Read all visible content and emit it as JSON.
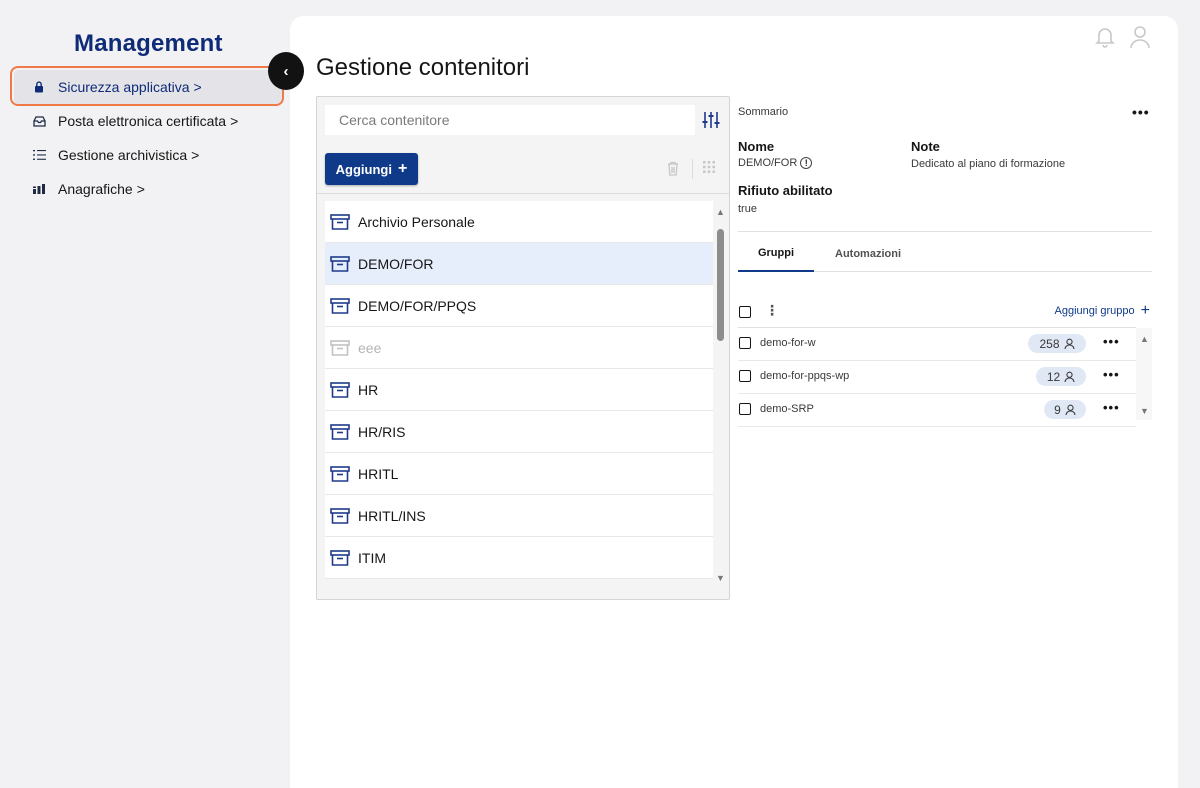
{
  "sidebar": {
    "title": "Management",
    "items": [
      {
        "label": "Sicurezza applicativa",
        "icon": "lock-icon",
        "chevron": ">"
      },
      {
        "label": "Posta elettronica certificata",
        "icon": "inbox-icon",
        "chevron": ">"
      },
      {
        "label": "Gestione archivistica",
        "icon": "list-icon",
        "chevron": ">"
      },
      {
        "label": "Anagrafiche",
        "icon": "chart-icon",
        "chevron": ">"
      }
    ],
    "collapse_glyph": "‹"
  },
  "header": {
    "title": "Gestione contenitori",
    "icons": [
      "bell-icon",
      "user-icon"
    ]
  },
  "list_panel": {
    "search_placeholder": "Cerca contenitore",
    "add_label": "Aggiungi",
    "add_plus": "+",
    "items": [
      {
        "label": "Archivio Personale",
        "state": "normal"
      },
      {
        "label": "DEMO/FOR",
        "state": "selected"
      },
      {
        "label": "DEMO/FOR/PPQS",
        "state": "normal"
      },
      {
        "label": "eee",
        "state": "disabled"
      },
      {
        "label": "HR",
        "state": "normal"
      },
      {
        "label": "HR/RIS",
        "state": "normal"
      },
      {
        "label": "HRITL",
        "state": "normal"
      },
      {
        "label": "HRITL/INS",
        "state": "normal"
      },
      {
        "label": "ITIM",
        "state": "normal"
      }
    ],
    "scroll_up": "▲",
    "scroll_down": "▼"
  },
  "details": {
    "summary_title": "Sommario",
    "menu_glyph": "•••",
    "name_label": "Nome",
    "name_value": "DEMO/FOR",
    "info_glyph": "!",
    "notes_label": "Note",
    "notes_value": "Dedicato al piano di formazione",
    "reject_label": "Rifiuto abilitato",
    "reject_value": "true",
    "tabs": [
      {
        "label": "Gruppi",
        "active": true
      },
      {
        "label": "Automazioni",
        "active": false
      }
    ],
    "kebab_glyph": "⋮",
    "add_group_label": "Aggiungi gruppo",
    "add_group_plus": "+",
    "groups": [
      {
        "name": "demo-for-w",
        "count": "258"
      },
      {
        "name": "demo-for-ppqs-wp",
        "count": "12"
      },
      {
        "name": "demo-SRP",
        "count": "9"
      }
    ],
    "row_menu_glyph": "•••",
    "scroll_up": "▲",
    "scroll_down": "▼"
  },
  "colors": {
    "brand": "#0f2b78",
    "primary_button": "#0f3a8a",
    "highlight_outline": "#ef7a48",
    "selected_row": "#e6eefb",
    "badge_bg": "#e1e8f5"
  }
}
